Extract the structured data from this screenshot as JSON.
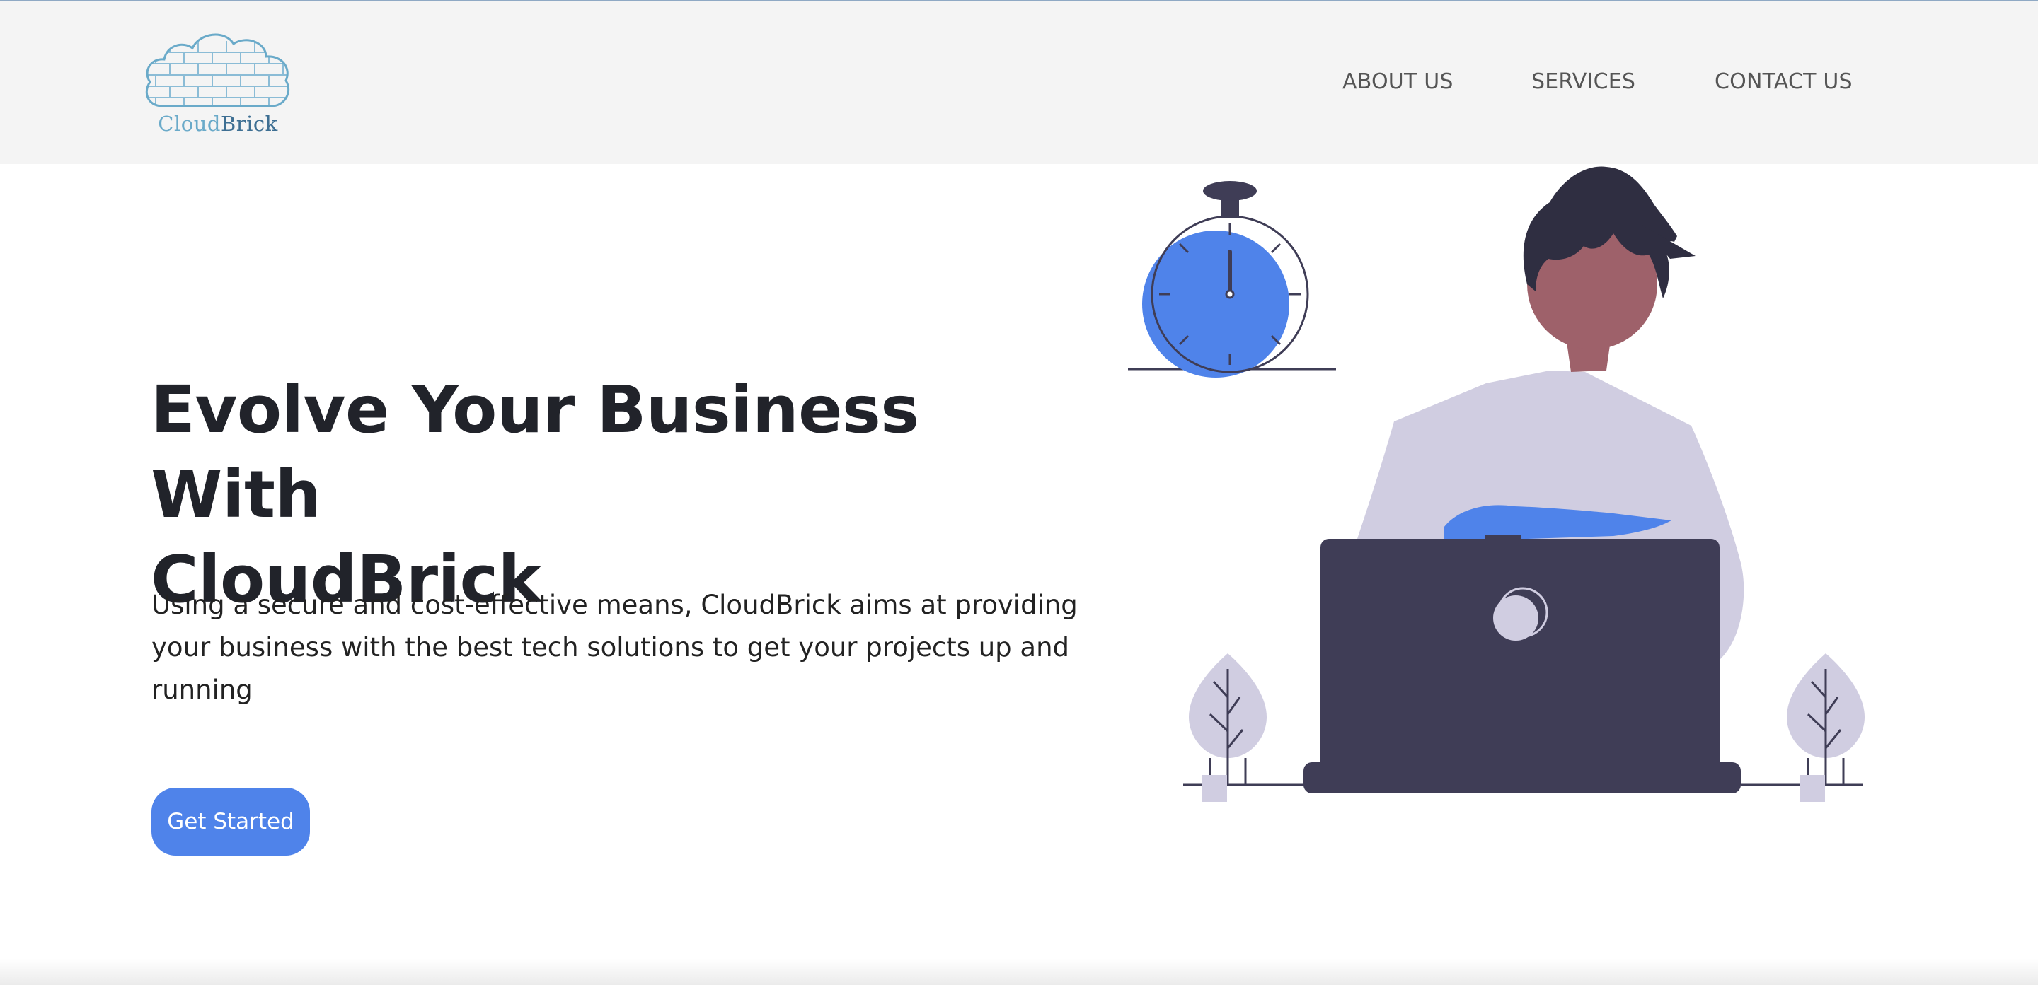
{
  "brand": {
    "name_part1": "Cloud",
    "name_part2": "Brick",
    "logo_icon": "brick-cloud-logo",
    "color_light": "#6aaac9",
    "color_dark": "#3e6f93"
  },
  "nav": {
    "items": [
      {
        "label": "ABOUT US"
      },
      {
        "label": "SERVICES"
      },
      {
        "label": "CONTACT US"
      }
    ]
  },
  "hero": {
    "title_line1": "Evolve Your Business With",
    "title_line2": "CloudBrick",
    "description": "Using a secure and cost-effective means, CloudBrick aims at providing your business with the best tech solutions to get your projects up and running",
    "cta_label": "Get Started"
  },
  "illustration": {
    "name": "person-working-on-laptop-with-stopwatch",
    "accent_color": "#4f83ea",
    "dark_color": "#3f3d56",
    "shirt_color": "#d0cde1",
    "skin_color": "#9e616a"
  }
}
